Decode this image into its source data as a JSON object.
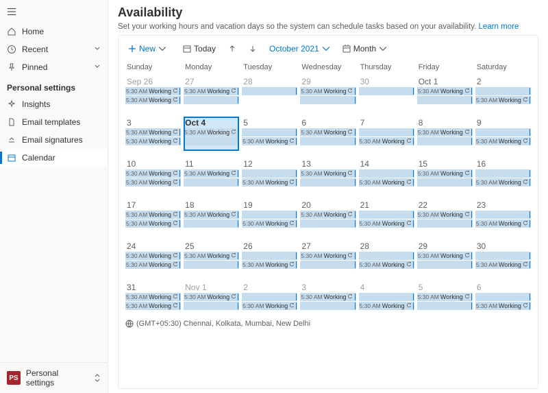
{
  "sidebar": {
    "top": [
      {
        "label": "Home",
        "icon": "home"
      },
      {
        "label": "Recent",
        "icon": "clock",
        "chevron": true
      },
      {
        "label": "Pinned",
        "icon": "pin",
        "chevron": true
      }
    ],
    "section": "Personal settings",
    "items": [
      {
        "label": "Insights",
        "icon": "sparkle"
      },
      {
        "label": "Email templates",
        "icon": "file"
      },
      {
        "label": "Email signatures",
        "icon": "sig"
      },
      {
        "label": "Calendar",
        "icon": "cal",
        "active": true
      }
    ],
    "footer": {
      "badge": "PS",
      "label": "Personal settings"
    }
  },
  "page": {
    "title": "Availability",
    "desc": "Set your working hours and vacation days so the system can schedule tasks based on your availability.",
    "learn": "Learn more"
  },
  "toolbar": {
    "new": "New",
    "today": "Today",
    "period": "October 2021",
    "view": "Month"
  },
  "dayHeaders": [
    "Sunday",
    "Monday",
    "Tuesday",
    "Wednesday",
    "Thursday",
    "Friday",
    "Saturday"
  ],
  "event": {
    "time": "5:30 AM",
    "title": "Working"
  },
  "weeks": [
    [
      {
        "label": "Sep 26",
        "out": true,
        "pattern": "AA"
      },
      {
        "label": "27",
        "out": true,
        "pattern": "AB"
      },
      {
        "label": "28",
        "out": true,
        "pattern": "B"
      },
      {
        "label": "29",
        "out": true,
        "pattern": "AB"
      },
      {
        "label": "30",
        "out": true,
        "pattern": "B"
      },
      {
        "label": "Oct 1",
        "pattern": "AB"
      },
      {
        "label": "2",
        "pattern": "BA"
      }
    ],
    [
      {
        "label": "3",
        "pattern": "AA"
      },
      {
        "label": "Oct 4",
        "pattern": "AB",
        "today": true
      },
      {
        "label": "5",
        "pattern": "BA"
      },
      {
        "label": "6",
        "pattern": "AB"
      },
      {
        "label": "7",
        "pattern": "BA"
      },
      {
        "label": "8",
        "pattern": "AB"
      },
      {
        "label": "9",
        "pattern": "BA"
      }
    ],
    [
      {
        "label": "10",
        "pattern": "AA"
      },
      {
        "label": "11",
        "pattern": "AB"
      },
      {
        "label": "12",
        "pattern": "BA"
      },
      {
        "label": "13",
        "pattern": "AB"
      },
      {
        "label": "14",
        "pattern": "BA"
      },
      {
        "label": "15",
        "pattern": "AB"
      },
      {
        "label": "16",
        "pattern": "BA"
      }
    ],
    [
      {
        "label": "17",
        "pattern": "AA"
      },
      {
        "label": "18",
        "pattern": "AB"
      },
      {
        "label": "19",
        "pattern": "BA"
      },
      {
        "label": "20",
        "pattern": "AB"
      },
      {
        "label": "21",
        "pattern": "BA"
      },
      {
        "label": "22",
        "pattern": "AB"
      },
      {
        "label": "23",
        "pattern": "BA"
      }
    ],
    [
      {
        "label": "24",
        "pattern": "AA"
      },
      {
        "label": "25",
        "pattern": "AB"
      },
      {
        "label": "26",
        "pattern": "BA"
      },
      {
        "label": "27",
        "pattern": "AB"
      },
      {
        "label": "28",
        "pattern": "BA"
      },
      {
        "label": "29",
        "pattern": "AB"
      },
      {
        "label": "30",
        "pattern": "BA"
      }
    ],
    [
      {
        "label": "31",
        "pattern": "AA"
      },
      {
        "label": "Nov 1",
        "out": true,
        "pattern": "AB"
      },
      {
        "label": "2",
        "out": true,
        "pattern": "BA"
      },
      {
        "label": "3",
        "out": true,
        "pattern": "AB"
      },
      {
        "label": "4",
        "out": true,
        "pattern": "BA"
      },
      {
        "label": "5",
        "out": true,
        "pattern": "AB"
      },
      {
        "label": "6",
        "out": true,
        "pattern": "BA"
      }
    ]
  ],
  "timezone": "(GMT+05:30) Chennai, Kolkata, Mumbai, New Delhi"
}
